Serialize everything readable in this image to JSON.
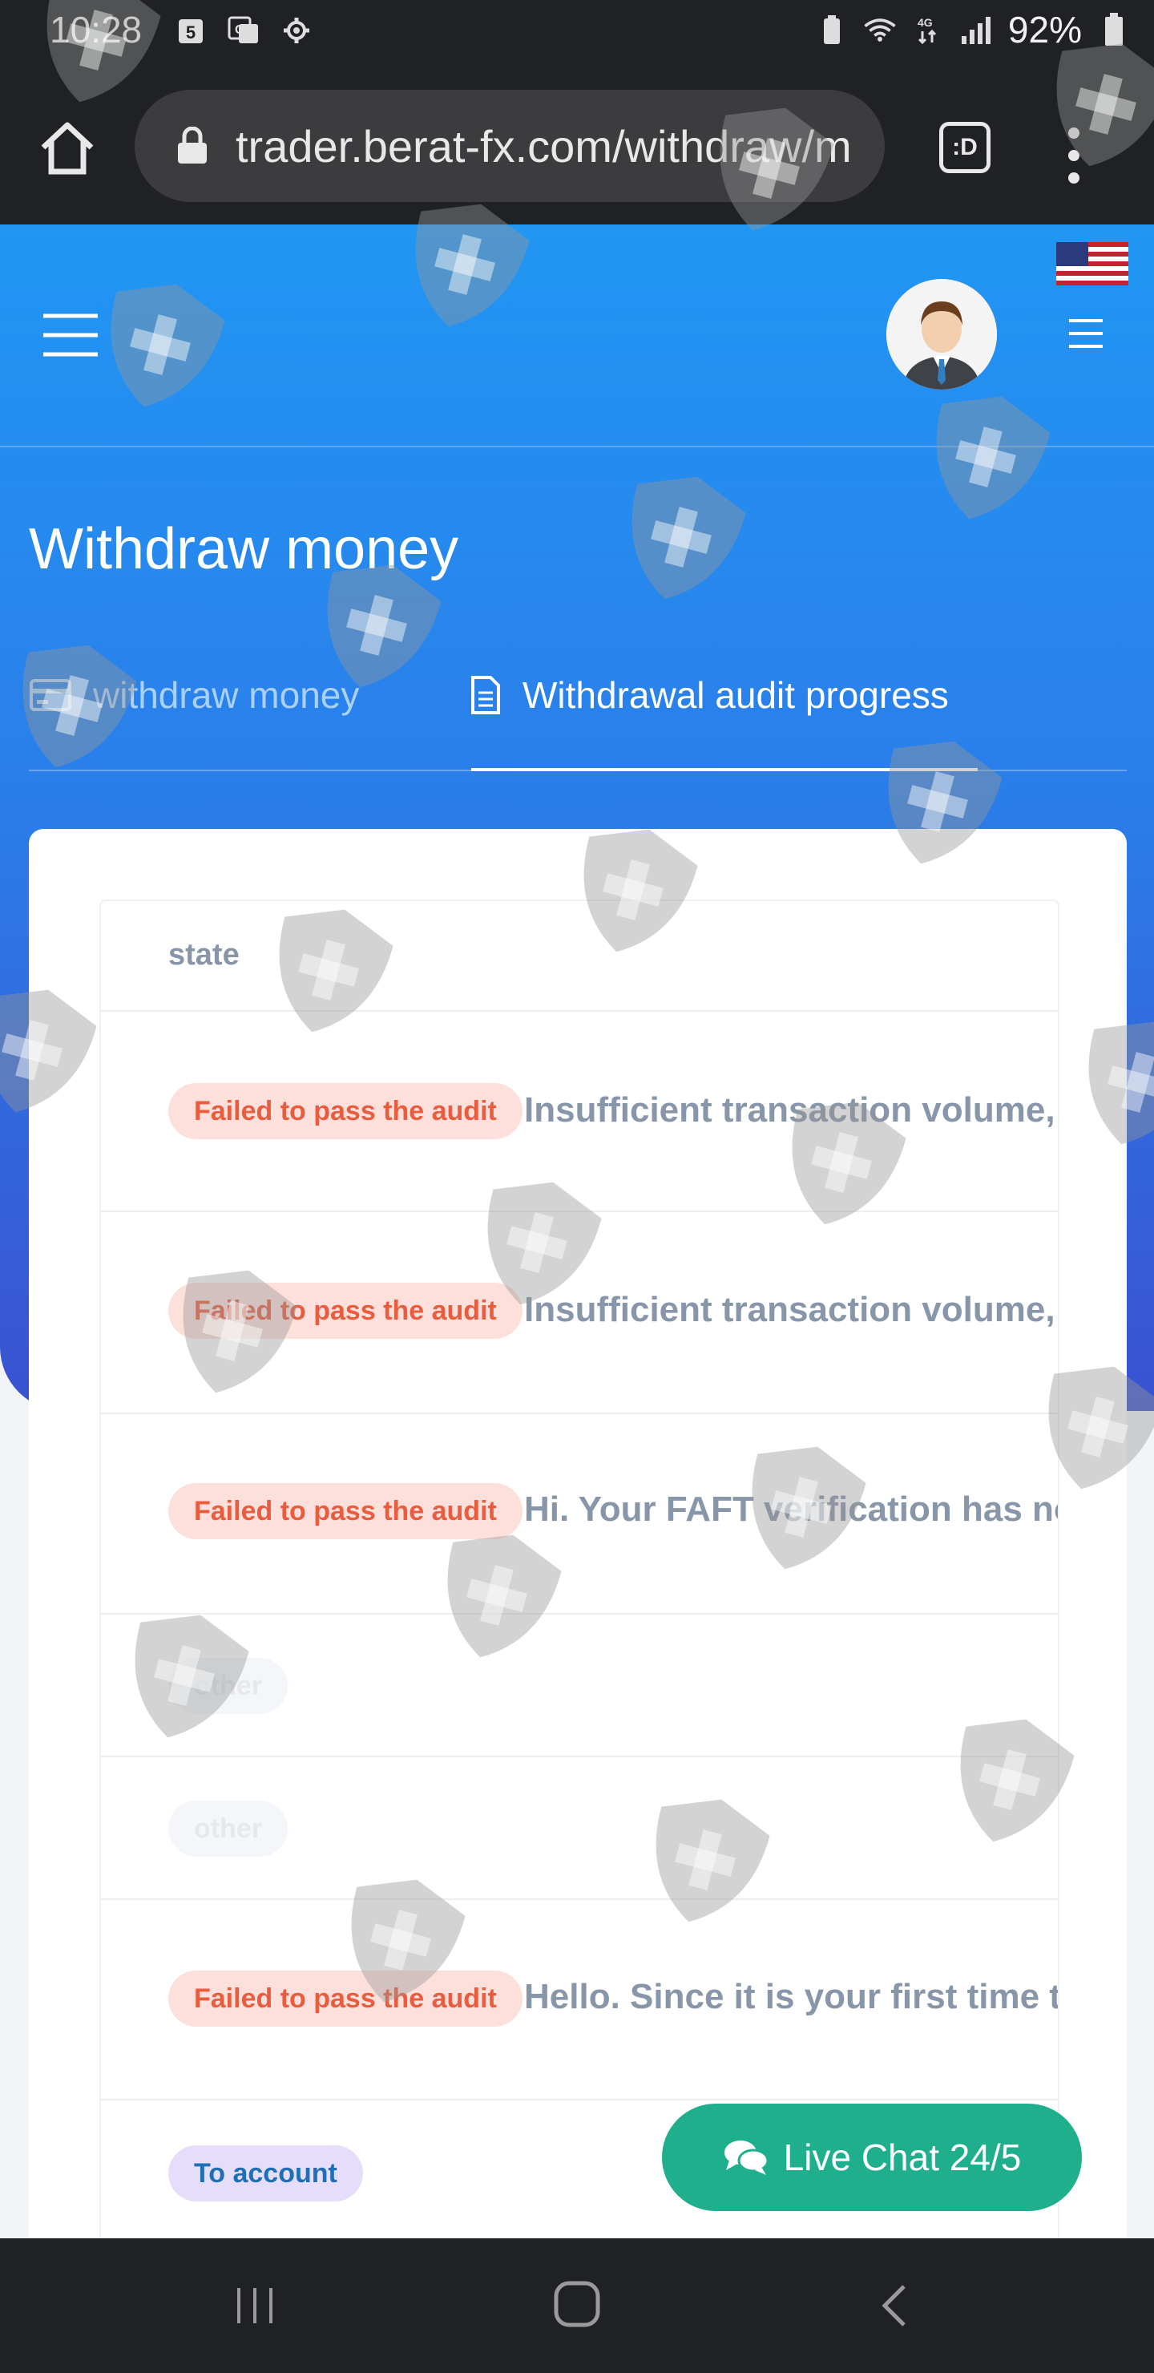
{
  "status_bar": {
    "time": "10:28",
    "battery": "92%"
  },
  "browser": {
    "url": "trader.berat-fx.com/withdraw/m",
    "tabs_label": ":D"
  },
  "page": {
    "title": "Withdraw money",
    "tabs": [
      {
        "label": "withdraw money",
        "active": false
      },
      {
        "label": "Withdrawal audit progress",
        "active": true
      }
    ]
  },
  "table": {
    "header": "state",
    "rows": [
      {
        "status": "Failed to pass the audit",
        "kind": "fail",
        "reason": "Insufficient transaction volume, u"
      },
      {
        "status": "Failed to pass the audit",
        "kind": "fail",
        "reason": "Insufficient transaction volume, u"
      },
      {
        "status": "Failed to pass the audit",
        "kind": "fail",
        "reason": "Hi. Your FAFT verification has no"
      },
      {
        "status": "other",
        "kind": "other",
        "reason": ""
      },
      {
        "status": "other",
        "kind": "other",
        "reason": ""
      },
      {
        "status": "Failed to pass the audit",
        "kind": "fail",
        "reason": "Hello. Since it is your first time to"
      },
      {
        "status": "To account",
        "kind": "account",
        "reason": ""
      }
    ]
  },
  "live_chat": {
    "label": "Live Chat 24/5",
    "color": "#1faf8c"
  },
  "colors": {
    "hero_top": "#2196f3",
    "hero_bottom": "#3a52d0",
    "fail_text": "#ea5c3e",
    "fail_bg": "#fde0db"
  }
}
